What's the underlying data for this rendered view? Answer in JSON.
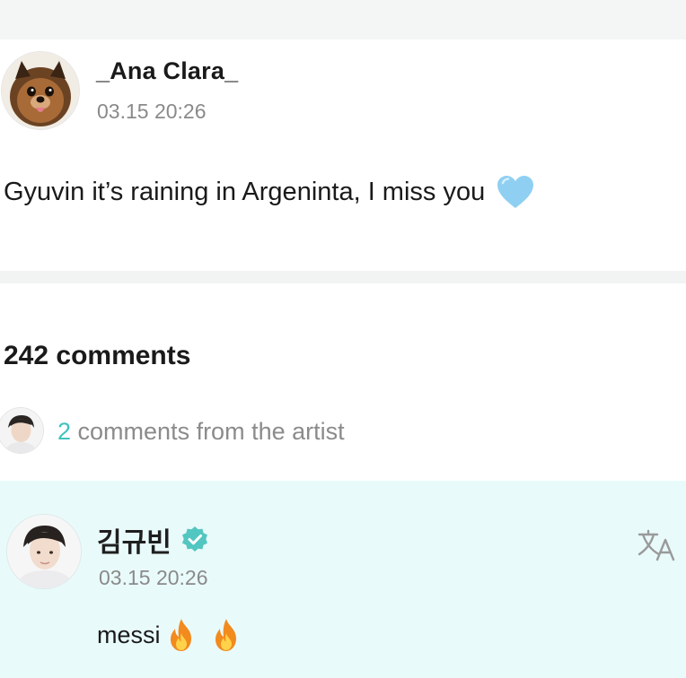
{
  "post": {
    "author": "_Ana Clara_",
    "timestamp": "03.15 20:26",
    "text": "Gyuvin it’s raining in Argeninta, I miss you",
    "emoji": "light-blue-heart-icon",
    "avatar": "dog-avatar"
  },
  "comments": {
    "count_label": "242 comments",
    "artist_row": {
      "count": "2",
      "label": " comments from the artist"
    }
  },
  "artist_comment": {
    "name": "김규빈",
    "verified": true,
    "timestamp": "03.15 20:26",
    "text": "messi",
    "emojis": [
      "fire-icon",
      "fire-icon"
    ],
    "translate_icon": "translate-icon"
  },
  "colors": {
    "accent": "#3ec3be",
    "artist_background": "#e9fafa",
    "verified": "#52c6c1",
    "heart": "#8fd0f2",
    "muted_text": "#8a8a8a"
  }
}
